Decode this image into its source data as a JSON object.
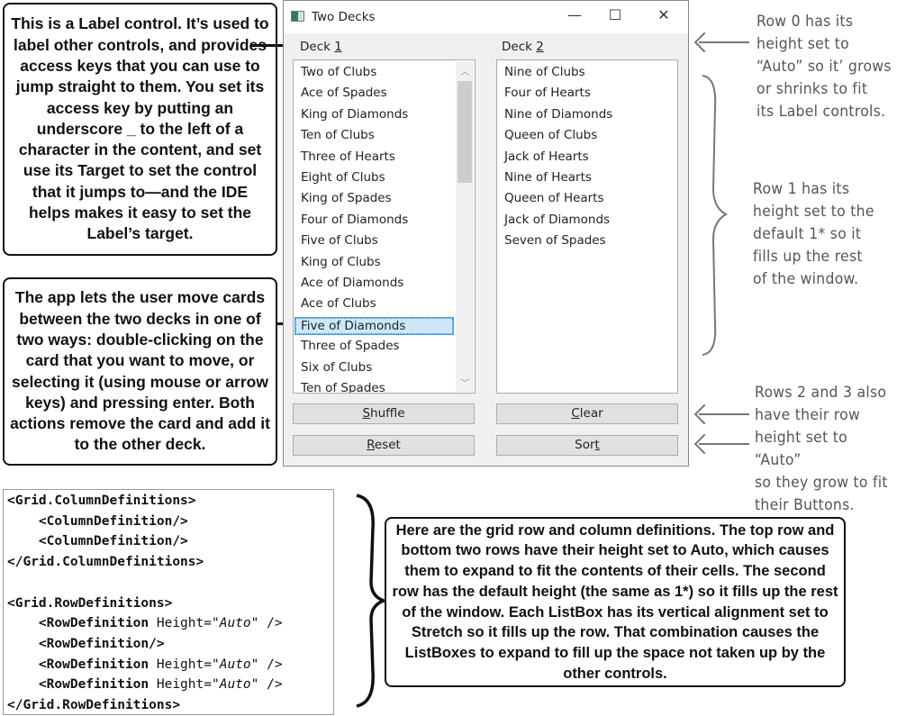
{
  "callouts": {
    "label_control": "This is a Label control. It’s used to label other controls, and provides access keys that you can use to jump straight to them. You set its access key by putting an underscore _ to the left of a character in the content, and set use its Target to set the control that it jumps to—and the IDE helps makes it easy to set the Label’s target.",
    "move_cards": "The app lets the user move cards between the two decks in one of two ways: double-clicking on the card that you want to move, or selecting it (using mouse or arrow keys) and pressing enter. Both actions remove the card and add it to the other deck.",
    "grid_defs": "Here are the grid row and column definitions. The top row and bottom two rows have their height set to Auto, which causes them to expand to fit the contents of their cells. The second row has the default height (the same as 1*) so it fills up the rest of the window. Each ListBox has its vertical alignment set to Stretch so it fills up the row. That combination causes the ListBoxes to expand to fill up the space not taken up by the other controls."
  },
  "window": {
    "title": "Two Decks",
    "controls": {
      "minimize": "—",
      "maximize": "☐",
      "close": "✕"
    },
    "deck1": {
      "pre": "Deck ",
      "key": "1",
      "post": ""
    },
    "deck2": {
      "pre": "Deck ",
      "key": "2",
      "post": ""
    },
    "deck1_items": [
      "Two of Clubs",
      "Ace of Spades",
      "King of Diamonds",
      "Ten of Clubs",
      "Three of Hearts",
      "Eight of Clubs",
      "King of Spades",
      "Four of Diamonds",
      "Five of Clubs",
      "King of Clubs",
      "Ace of Diamonds",
      "Ace of Clubs",
      "Five of Diamonds",
      "Three of Spades",
      "Six of Clubs",
      "Ten of Spades"
    ],
    "deck1_selected": "Five of Diamonds",
    "deck2_items": [
      "Nine of Clubs",
      "Four of Hearts",
      "Nine of Diamonds",
      "Queen of Clubs",
      "Jack of Hearts",
      "Nine of Hearts",
      "Queen of Hearts",
      "Jack of Diamonds",
      "Seven of Spades"
    ],
    "buttons": {
      "shuffle": {
        "pre": "",
        "key": "S",
        "post": "huffle"
      },
      "clear": {
        "pre": "",
        "key": "C",
        "post": "lear"
      },
      "reset": {
        "pre": "",
        "key": "R",
        "post": "eset"
      },
      "sort": {
        "pre": "Sor",
        "key": "t",
        "post": ""
      }
    }
  },
  "notes": {
    "row0": "Row 0 has its\nheight set to\n“Auto” so it’ grows\nor shrinks to fit\nits Label controls.",
    "row1": "Row 1 has its\nheight set to the\ndefault 1* so it\nfills up the rest\nof the window.",
    "rows23": "Rows 2 and 3 also\nhave their row\nheight set to “Auto”\nso they grow to fit\ntheir Buttons."
  },
  "code": [
    {
      "tag": "<Grid.ColumnDefinitions>"
    },
    {
      "tag": "    <ColumnDefinition/>"
    },
    {
      "tag": "    <ColumnDefinition/>"
    },
    {
      "tag": "</Grid.ColumnDefinitions>"
    },
    {
      "tag": ""
    },
    {
      "tag": "<Grid.RowDefinitions>"
    },
    {
      "tag": "    <RowDefinition",
      "attr": " Height=\"",
      "val": "Auto",
      "end": "\" />"
    },
    {
      "tag": "    <RowDefinition/>"
    },
    {
      "tag": "    <RowDefinition",
      "attr": " Height=\"",
      "val": "Auto",
      "end": "\" />"
    },
    {
      "tag": "    <RowDefinition",
      "attr": " Height=\"",
      "val": "Auto",
      "end": "\" />"
    },
    {
      "tag": "</Grid.RowDefinitions>"
    }
  ]
}
